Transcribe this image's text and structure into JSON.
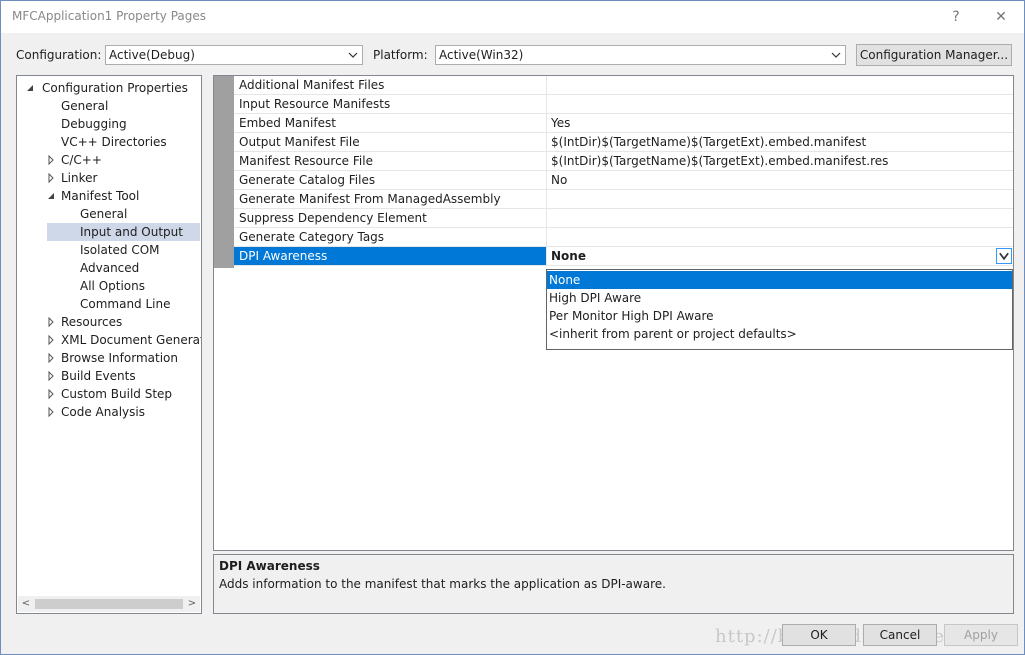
{
  "window": {
    "title": "MFCApplication1 Property Pages",
    "help_glyph": "?",
    "close_glyph": "✕"
  },
  "toolbar": {
    "configuration_label": "Configuration:",
    "configuration_value": "Active(Debug)",
    "platform_label": "Platform:",
    "platform_value": "Active(Win32)",
    "config_manager_button": "Configuration Manager..."
  },
  "tree": {
    "items": [
      {
        "label": "Configuration Properties",
        "state": "expanded"
      },
      {
        "label": "General",
        "state": "leaf"
      },
      {
        "label": "Debugging",
        "state": "leaf"
      },
      {
        "label": "VC++ Directories",
        "state": "leaf"
      },
      {
        "label": "C/C++",
        "state": "collapsed"
      },
      {
        "label": "Linker",
        "state": "collapsed"
      },
      {
        "label": "Manifest Tool",
        "state": "expanded"
      },
      {
        "label": "General",
        "state": "leaf"
      },
      {
        "label": "Input and Output",
        "state": "leaf",
        "selected": true
      },
      {
        "label": "Isolated COM",
        "state": "leaf"
      },
      {
        "label": "Advanced",
        "state": "leaf"
      },
      {
        "label": "All Options",
        "state": "leaf"
      },
      {
        "label": "Command Line",
        "state": "leaf"
      },
      {
        "label": "Resources",
        "state": "collapsed"
      },
      {
        "label": "XML Document Generator",
        "state": "collapsed"
      },
      {
        "label": "Browse Information",
        "state": "collapsed"
      },
      {
        "label": "Build Events",
        "state": "collapsed"
      },
      {
        "label": "Custom Build Step",
        "state": "collapsed"
      },
      {
        "label": "Code Analysis",
        "state": "collapsed"
      }
    ],
    "scroll_left_glyph": "<",
    "scroll_right_glyph": ">"
  },
  "properties": [
    {
      "name": "Additional Manifest Files",
      "value": ""
    },
    {
      "name": "Input Resource Manifests",
      "value": ""
    },
    {
      "name": "Embed Manifest",
      "value": "Yes"
    },
    {
      "name": "Output Manifest File",
      "value": "$(IntDir)$(TargetName)$(TargetExt).embed.manifest"
    },
    {
      "name": "Manifest Resource File",
      "value": "$(IntDir)$(TargetName)$(TargetExt).embed.manifest.res"
    },
    {
      "name": "Generate Catalog Files",
      "value": "No"
    },
    {
      "name": "Generate Manifest From ManagedAssembly",
      "value": ""
    },
    {
      "name": "Suppress Dependency Element",
      "value": ""
    },
    {
      "name": "Generate Category Tags",
      "value": ""
    },
    {
      "name": "DPI Awareness",
      "value": "None",
      "active": true
    }
  ],
  "dpi_dropdown": {
    "options": [
      "None",
      "High DPI Aware",
      "Per Monitor High DPI Aware",
      "<inherit from parent or project defaults>"
    ],
    "selected": "None"
  },
  "description": {
    "title": "DPI Awareness",
    "text": "Adds information to the manifest that marks the application as DPI-aware."
  },
  "footer": {
    "ok": "OK",
    "cancel": "Cancel",
    "apply": "Apply",
    "watermark": "http://blog.csdn.net/deffliang"
  }
}
